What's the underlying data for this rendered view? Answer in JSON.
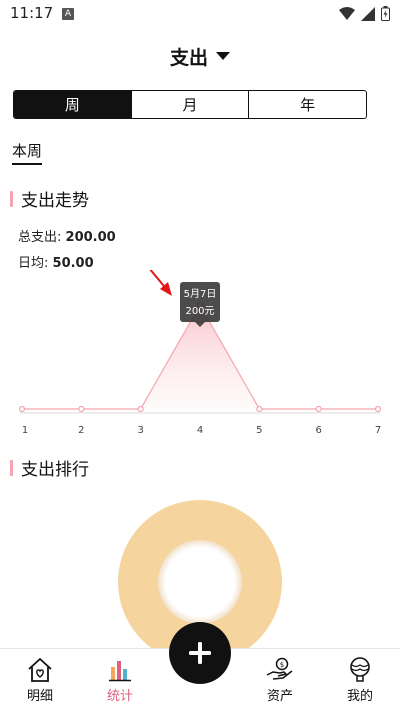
{
  "status": {
    "time": "11:17",
    "notif_letter": "A"
  },
  "header": {
    "title": "支出"
  },
  "segments": [
    "周",
    "月",
    "年"
  ],
  "period_tab": "本周",
  "trend": {
    "title": "支出走势",
    "total_label": "总支出:",
    "total_value": "200.00",
    "avg_label": "日均:",
    "avg_value": "50.00",
    "tooltip_date": "5月7日",
    "tooltip_value": "200元"
  },
  "ranking": {
    "title": "支出排行"
  },
  "chart_data": {
    "type": "area",
    "x": [
      "1",
      "2",
      "3",
      "4",
      "5",
      "6",
      "7"
    ],
    "values": [
      0,
      0,
      0,
      200,
      0,
      0,
      0
    ],
    "color": "#f5a5ae"
  },
  "donut": {
    "color": "#f5d49e"
  },
  "nav": {
    "items": [
      {
        "label": "明细",
        "icon": "house-heart-icon"
      },
      {
        "label": "统计",
        "icon": "bar-chart-icon"
      },
      {
        "label": "资产",
        "icon": "hand-coin-icon"
      },
      {
        "label": "我的",
        "icon": "balloon-icon"
      }
    ],
    "active_color": "#e0607e"
  }
}
